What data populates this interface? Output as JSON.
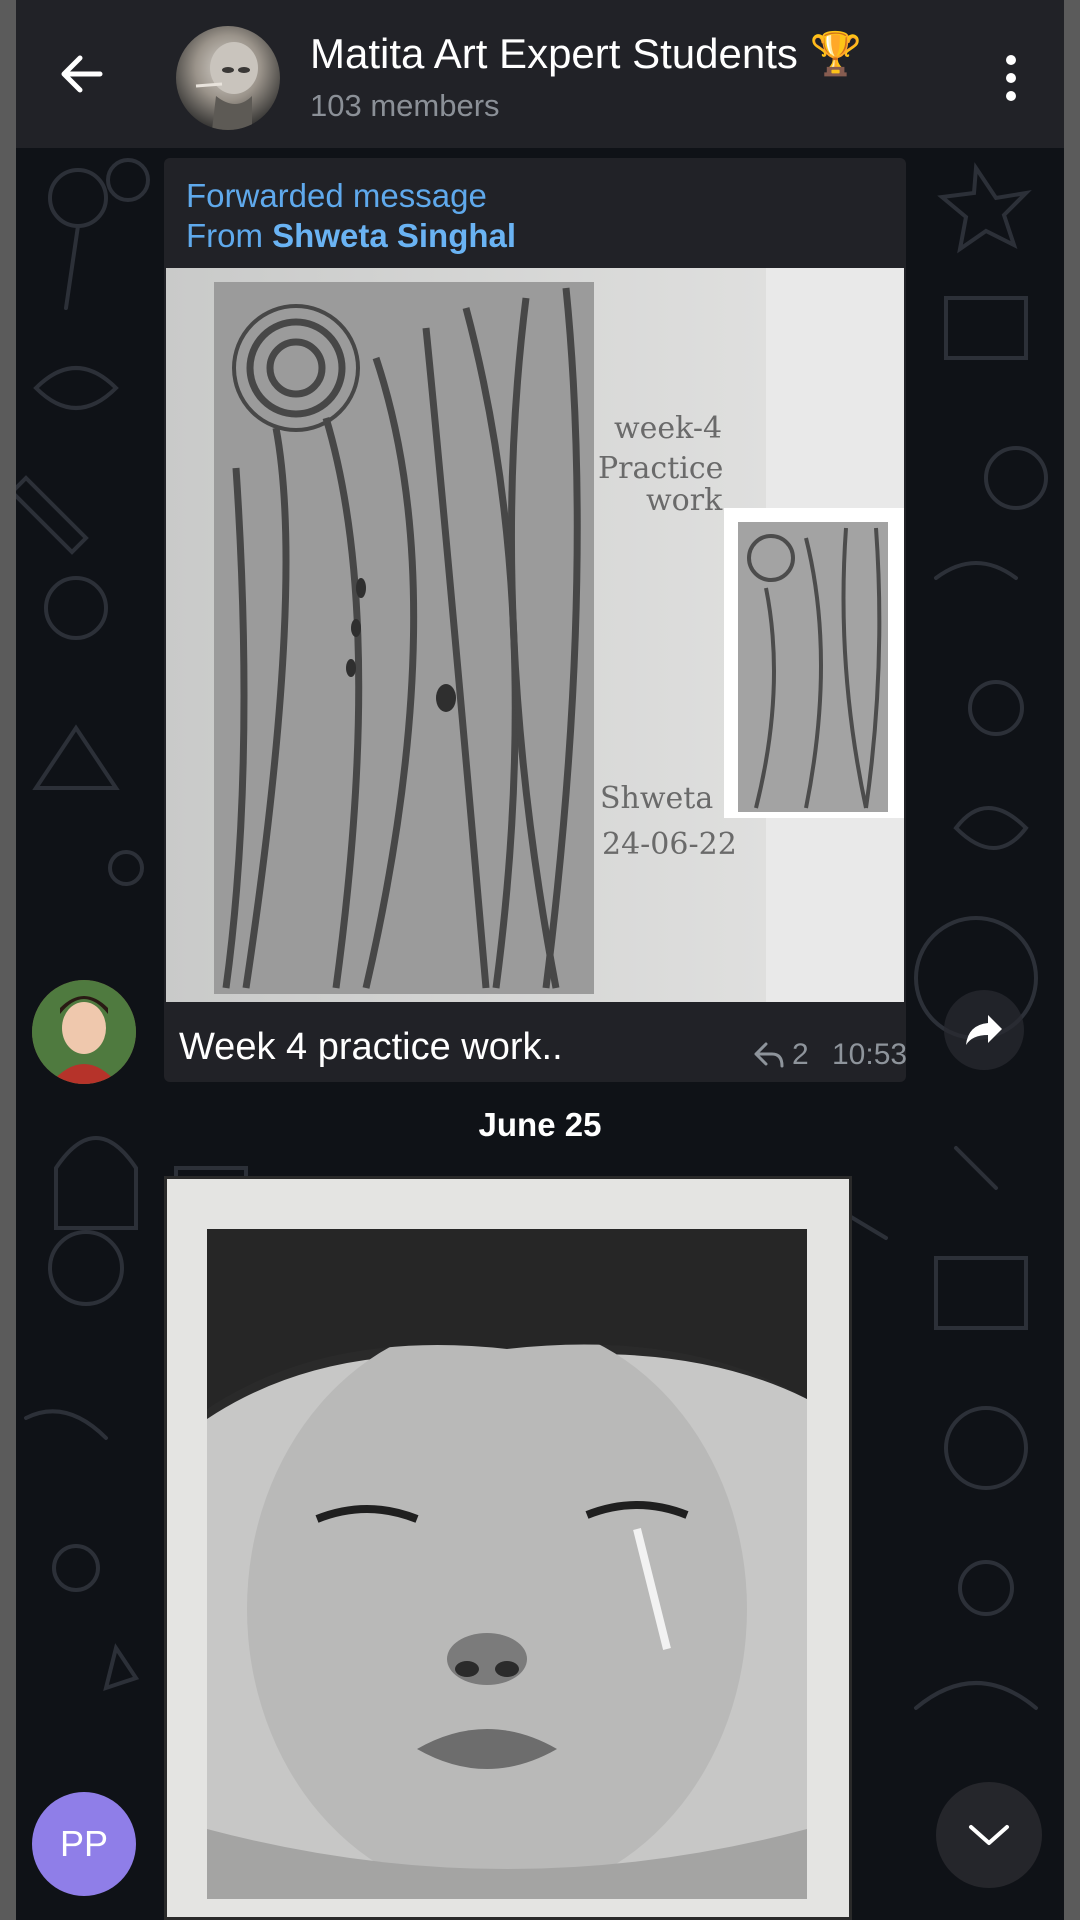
{
  "header": {
    "back_icon": "arrow-left-icon",
    "group_name": "Matita Art Expert Students 🏆",
    "members": "103 members",
    "menu_icon": "more-vertical-icon"
  },
  "message1": {
    "forwarded_label": "Forwarded message",
    "from_prefix": "From ",
    "from_name": "Shweta Singhal",
    "photo_note_line1": "week-4",
    "photo_note_line2": "Practice",
    "photo_note_line3": "work",
    "photo_signature": "Shweta",
    "photo_date": "24-06-22",
    "caption": "Week 4 practice work..",
    "reply_count": "2",
    "time": "10:53"
  },
  "date_separator": "June 25",
  "composer_avatar": {
    "initials": "PP",
    "color": "#8f7ee8"
  },
  "colors": {
    "header_bg": "#212227",
    "chat_bg": "#0f1217",
    "link_blue": "#5fa9ec"
  }
}
